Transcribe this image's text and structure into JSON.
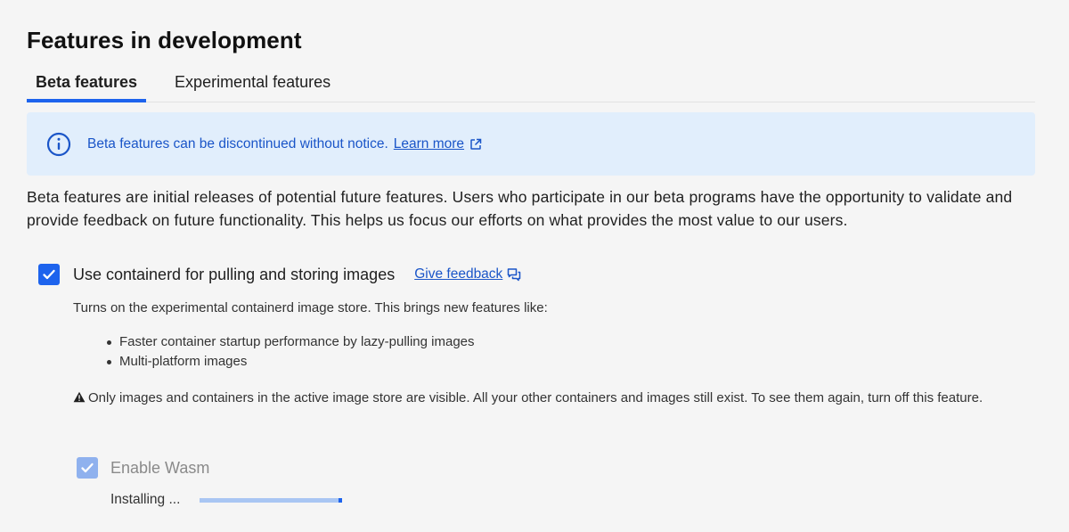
{
  "page": {
    "title": "Features in development"
  },
  "tabs": [
    {
      "label": "Beta features",
      "active": true
    },
    {
      "label": "Experimental features",
      "active": false
    }
  ],
  "banner": {
    "icon": "info-icon",
    "text": "Beta features can be discontinued without notice.",
    "link_label": "Learn more",
    "link_icon": "external-link-icon"
  },
  "description": "Beta features are initial releases of potential future features. Users who participate in our beta programs have the opportunity to validate and provide feedback on future functionality. This helps us focus our efforts on what provides the most value to our users.",
  "feature": {
    "checked": true,
    "label": "Use containerd for pulling and storing images",
    "feedback_label": "Give feedback",
    "feedback_icon": "feedback-icon",
    "description": "Turns on the experimental containerd image store. This brings new features like:",
    "bullets": [
      "Faster container startup performance by lazy-pulling images",
      "Multi-platform images"
    ],
    "warning_icon": "warning-icon",
    "warning": "Only images and containers in the active image store are visible. All your other containers and images still exist. To see them again, turn off this feature."
  },
  "sub_feature": {
    "checked": true,
    "disabled": true,
    "label": "Enable Wasm",
    "status": "Installing ...",
    "progress": 1.0
  },
  "colors": {
    "accent": "#1d63ed",
    "banner_bg": "#e1eefc",
    "link": "#1a55c8",
    "background": "#f5f5f5"
  }
}
